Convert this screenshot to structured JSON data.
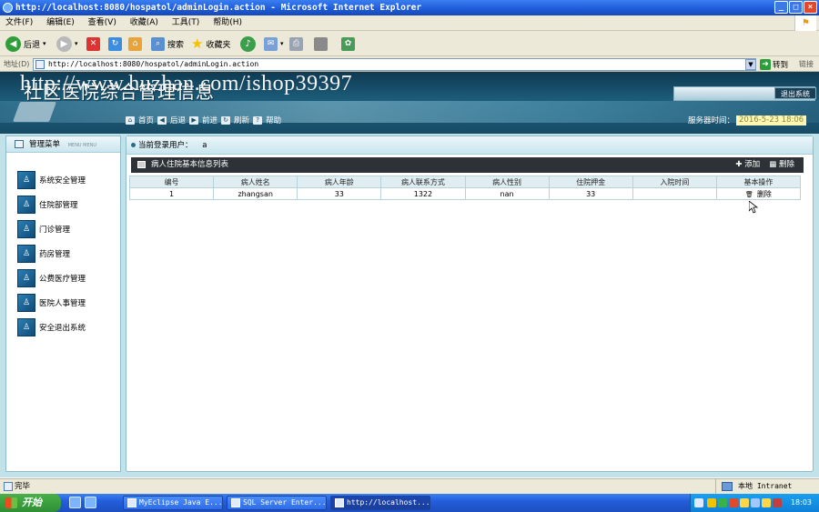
{
  "window": {
    "title": "http://localhost:8080/hospatol/adminLogin.action - Microsoft Internet Explorer",
    "controls": [
      "_",
      "□",
      "×"
    ]
  },
  "menubar": [
    "文件(F)",
    "编辑(E)",
    "查看(V)",
    "收藏(A)",
    "工具(T)",
    "帮助(H)"
  ],
  "toolbar": {
    "back": "后退",
    "search": "搜索",
    "favorites": "收藏夹"
  },
  "addressbar": {
    "label": "地址(D)",
    "url": "http://localhost:8080/hospatol/adminLogin.action",
    "go": "转到",
    "links": "链接"
  },
  "header": {
    "title": "社区医院综合管理信息",
    "watermark": "http://www.huzhan.com/ishop39397",
    "logout": "退出系统",
    "nav": [
      "首页",
      "后退",
      "前进",
      "刷新",
      "帮助"
    ],
    "server_time_label": "服务器时间：",
    "server_time": "2016-5-23 18:06"
  },
  "sidebar": {
    "header": "管理菜单",
    "header_sub": "MENU MENU",
    "items": [
      "系统安全管理",
      "住院部管理",
      "门诊管理",
      "药房管理",
      "公费医疗管理",
      "医院人事管理",
      "安全退出系统"
    ]
  },
  "main": {
    "current_user_label": "当前登录用户：",
    "current_user": "a",
    "list_title": "病人住院基本信息列表",
    "add": "添加",
    "delete": "删除",
    "columns": [
      "编号",
      "病人姓名",
      "病人年龄",
      "病人联系方式",
      "病人性别",
      "住院押金",
      "入院时间",
      "基本操作"
    ],
    "rows": [
      [
        "1",
        "zhangsan",
        "33",
        "1322",
        "nan",
        "33",
        "",
        "删除"
      ]
    ]
  },
  "statusbar": {
    "left": "完毕",
    "zone": "本地 Intranet"
  },
  "taskbar": {
    "start": "开始",
    "tasks": [
      "MyEclipse Java E...",
      "SQL Server Enter...",
      "http://localhost..."
    ],
    "clock": "18:03"
  },
  "colors": {
    "header_bg": "#1c5c7a",
    "frame_bg": "#c2e2ea",
    "list_bar": "#2e3236",
    "taskbar": "#245edb"
  }
}
